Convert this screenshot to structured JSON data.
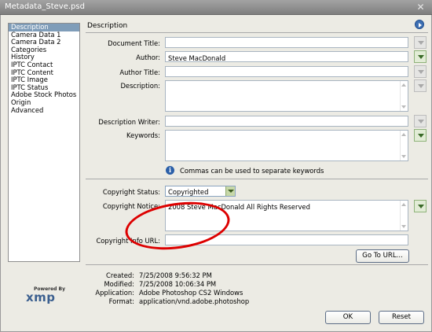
{
  "window": {
    "title": "Metadata_Steve.psd",
    "close_glyph": "✕"
  },
  "sidebar": {
    "items": [
      {
        "label": "Description",
        "selected": true
      },
      {
        "label": "Camera Data 1"
      },
      {
        "label": "Camera Data 2"
      },
      {
        "label": "Categories"
      },
      {
        "label": "History"
      },
      {
        "label": "IPTC Contact"
      },
      {
        "label": "IPTC Content"
      },
      {
        "label": "IPTC Image"
      },
      {
        "label": "IPTC Status"
      },
      {
        "label": "Adobe Stock Photos"
      },
      {
        "label": "Origin"
      },
      {
        "label": "Advanced"
      }
    ]
  },
  "branding": {
    "powered_by": "Powered By",
    "logo": "xmp"
  },
  "section": {
    "title": "Description",
    "menu_icon": "play-circle-icon"
  },
  "fields": {
    "document_title": {
      "label": "Document Title:",
      "value": ""
    },
    "author": {
      "label": "Author:",
      "value": "Steve MacDonald"
    },
    "author_title": {
      "label": "Author Title:",
      "value": ""
    },
    "description": {
      "label": "Description:",
      "value": ""
    },
    "description_writer": {
      "label": "Description Writer:",
      "value": ""
    },
    "keywords": {
      "label": "Keywords:",
      "value": ""
    },
    "copyright_status": {
      "label": "Copyright Status:",
      "value": "Copyrighted"
    },
    "copyright_notice": {
      "label": "Copyright Notice:",
      "value": "2008 Steve MacDonald All Rights Reserved"
    },
    "copyright_url": {
      "label": "Copyright Info URL:",
      "value": ""
    }
  },
  "keywords_hint": {
    "icon": "info-icon",
    "text": "Commas can be used to separate keywords"
  },
  "go_to_url_button": "Go To URL...",
  "file_info": [
    {
      "key": "Created:",
      "value": "7/25/2008 9:56:32 PM"
    },
    {
      "key": "Modified:",
      "value": "7/25/2008 10:06:34 PM"
    },
    {
      "key": "Application:",
      "value": "Adobe Photoshop CS2 Windows"
    },
    {
      "key": "Format:",
      "value": "application/vnd.adobe.photoshop"
    }
  ],
  "buttons": {
    "ok": "OK",
    "reset": "Reset"
  },
  "colors": {
    "selection": "#7f9db9",
    "annotation_circle": "#dd0000",
    "titlebar": "#8d8d8d"
  }
}
